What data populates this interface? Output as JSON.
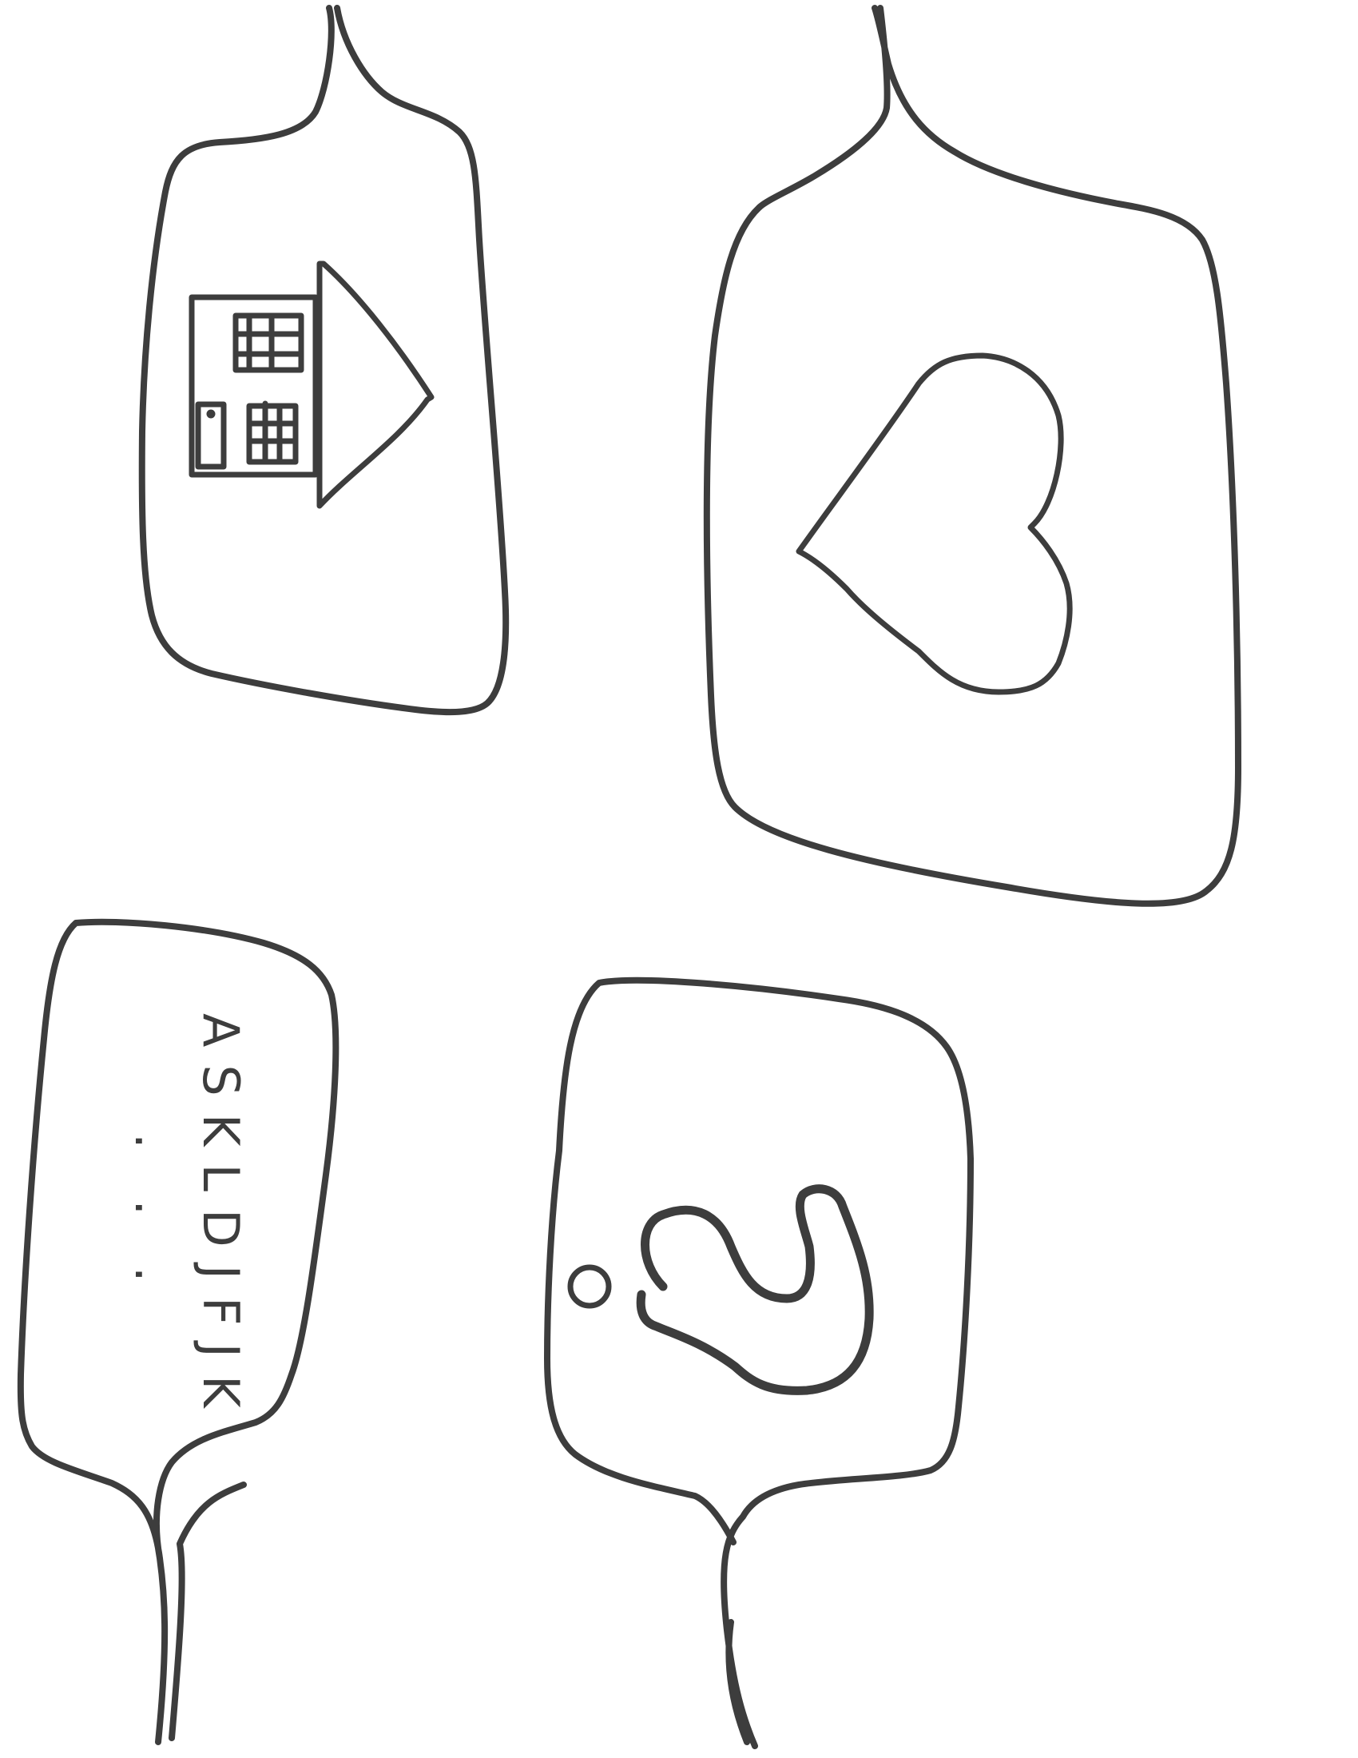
{
  "sheet": {
    "background_color": "#ffffff",
    "ink_color": "#3d3d3d"
  },
  "bubbles": [
    {
      "name": "house-bubble",
      "tail": "top",
      "icon": "house-icon"
    },
    {
      "name": "heart-bubble",
      "tail": "top",
      "icon": "heart-icon"
    },
    {
      "name": "text-bubble",
      "tail": "bottom",
      "text": "ASKLDJFJK",
      "ellipsis": ". . ."
    },
    {
      "name": "question-bubble",
      "tail": "bottom",
      "icon": "question-mark-icon"
    }
  ]
}
